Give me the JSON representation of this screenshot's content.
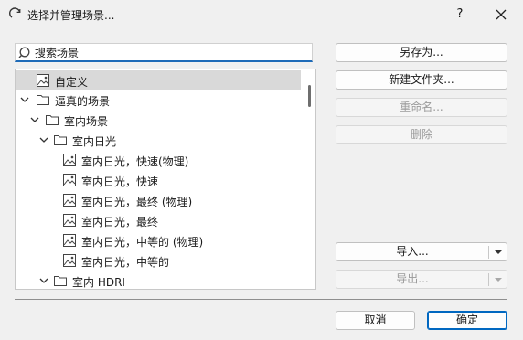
{
  "window": {
    "title": "选择并管理场景...",
    "help_label": "?"
  },
  "search": {
    "placeholder": "搜索场景",
    "value": ""
  },
  "tree": [
    {
      "label": "自定义",
      "icon": "scene-image-icon",
      "selected": true
    },
    {
      "label": "逼真的场景",
      "icon": "folder-icon",
      "expanded": true
    },
    {
      "label": "室内场景",
      "icon": "folder-icon",
      "expanded": true
    },
    {
      "label": "室内日光",
      "icon": "folder-icon",
      "expanded": true
    },
    {
      "label": "室内日光，快速(物理)",
      "icon": "scene-image-icon"
    },
    {
      "label": "室内日光，快速",
      "icon": "scene-image-icon"
    },
    {
      "label": "室内日光，最终 (物理)",
      "icon": "scene-image-icon"
    },
    {
      "label": "室内日光，最终",
      "icon": "scene-image-icon"
    },
    {
      "label": "室内日光，中等的 (物理)",
      "icon": "scene-image-icon"
    },
    {
      "label": "室内日光，中等的",
      "icon": "scene-image-icon"
    },
    {
      "label": "室内 HDRI",
      "icon": "folder-icon",
      "expanded": true
    }
  ],
  "actions": {
    "save_as": "另存为...",
    "new_folder": "新建文件夹...",
    "rename": "重命名...",
    "delete": "删除",
    "import": "导入...",
    "export": "导出..."
  },
  "footer": {
    "cancel": "取消",
    "ok": "确定"
  },
  "colors": {
    "accent": "#0067c0",
    "selection": "#d9d9d9",
    "window_bg": "#f0f0f0"
  }
}
